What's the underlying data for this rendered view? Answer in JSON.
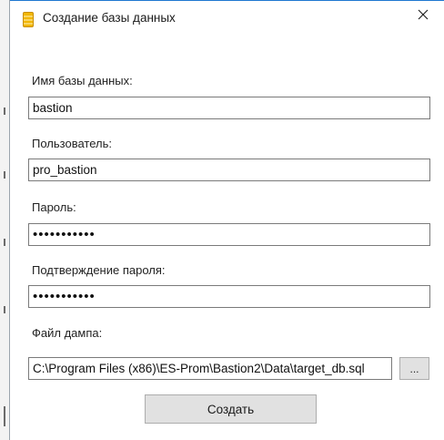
{
  "window": {
    "title": "Создание базы данных",
    "title_icon": "database-icon",
    "close_glyph": "close-icon"
  },
  "form": {
    "db_name": {
      "label": "Имя базы данных:",
      "value": "bastion"
    },
    "user": {
      "label": "Пользователь:",
      "value": "pro_bastion"
    },
    "password": {
      "label": "Пароль:",
      "value": "•••••••••••"
    },
    "password_confirm": {
      "label": "Подтверждение пароля:",
      "value": "•••••••••••"
    },
    "dump_file": {
      "label": "Файл дампа:",
      "value": "C:\\Program Files (x86)\\ES-Prom\\Bastion2\\Data\\target_db.sql"
    }
  },
  "buttons": {
    "browse_label": "...",
    "create_label": "Создать"
  },
  "colors": {
    "accent_border": "#1f78d1",
    "button_bg": "#e1e1e1",
    "input_border": "#7a7a7a",
    "icon_yellow": "#f2b705"
  }
}
